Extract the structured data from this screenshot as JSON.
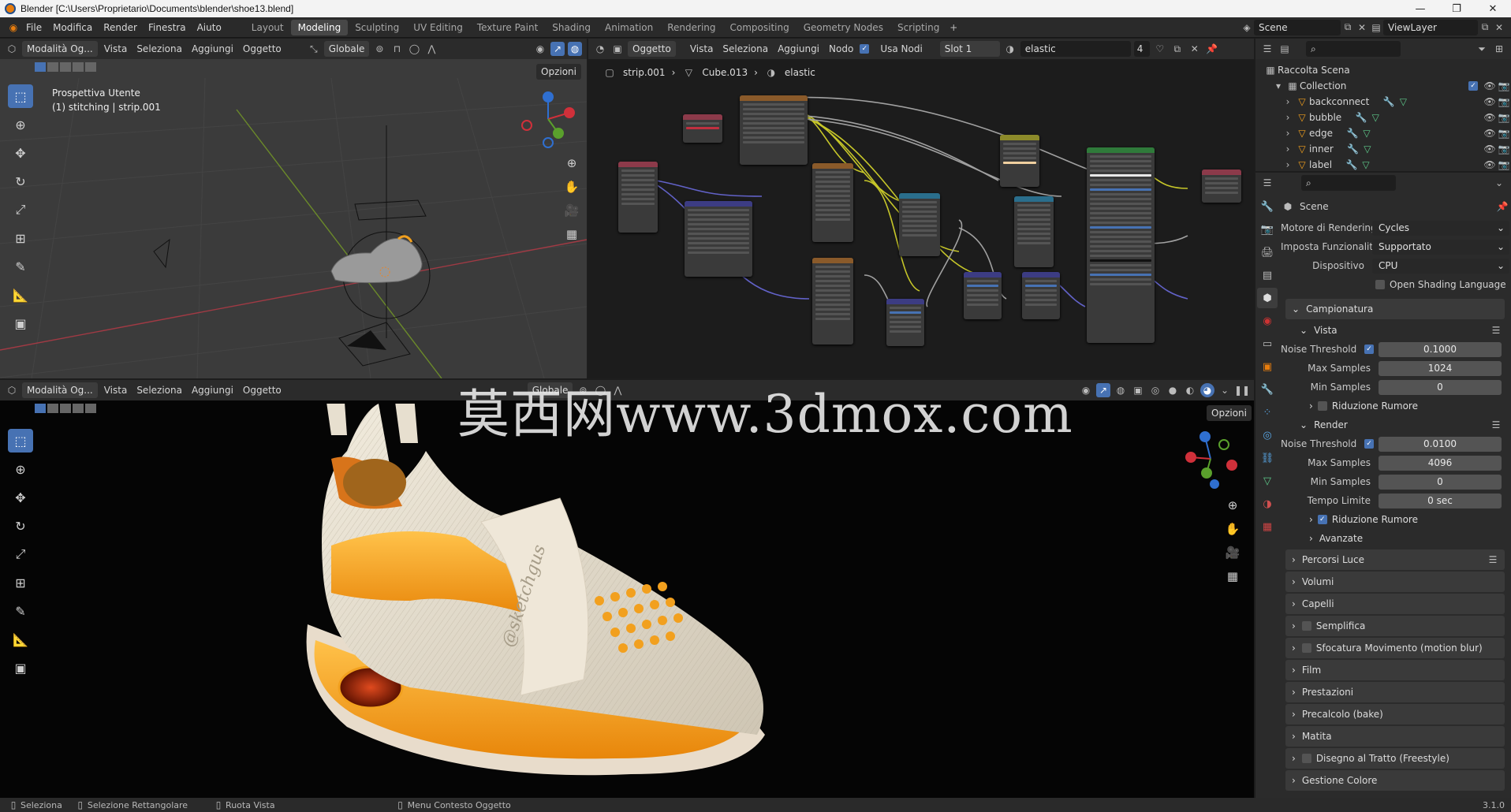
{
  "window": {
    "title": "Blender [C:\\Users\\Proprietario\\Documents\\blender\\shoe13.blend]"
  },
  "topbar": {
    "menus": [
      "File",
      "Modifica",
      "Render",
      "Finestra",
      "Aiuto"
    ],
    "workspaces": [
      "Layout",
      "Modeling",
      "Sculpting",
      "UV Editing",
      "Texture Paint",
      "Shading",
      "Animation",
      "Rendering",
      "Compositing",
      "Geometry Nodes",
      "Scripting"
    ],
    "active_workspace": "Modeling",
    "scene": "Scene",
    "viewlayer": "ViewLayer"
  },
  "viewport_top": {
    "mode": "Modalità Og...",
    "menus": [
      "Vista",
      "Seleziona",
      "Aggiungi",
      "Oggetto"
    ],
    "orientation": "Globale",
    "options": "Opzioni",
    "overlay_line1": "Prospettiva Utente",
    "overlay_line2": "(1) stitching | strip.001"
  },
  "node_editor": {
    "object_type": "Oggetto",
    "menus": [
      "Vista",
      "Seleziona",
      "Aggiungi",
      "Nodo"
    ],
    "use_nodes": "Usa Nodi",
    "slot": "Slot 1",
    "material": "elastic",
    "users": "4",
    "breadcrumb": [
      "strip.001",
      "Cube.013",
      "elastic"
    ]
  },
  "viewport_bottom": {
    "mode": "Modalità Og...",
    "menus": [
      "Vista",
      "Seleziona",
      "Aggiungi",
      "Oggetto"
    ],
    "orientation": "Globale",
    "options": "Opzioni",
    "watermark": "莫西网www.3dmox.com",
    "render_signature": "@sketchgus"
  },
  "outliner": {
    "root": "Raccolta Scena",
    "collection": "Collection",
    "items": [
      "backconnect",
      "bubble",
      "edge",
      "inner",
      "label"
    ]
  },
  "properties": {
    "context": "Scene",
    "engine_label": "Motore di Rendering",
    "engine": "Cycles",
    "feature_label": "Imposta Funzionalità",
    "feature": "Supportato",
    "device_label": "Dispositivo",
    "device": "CPU",
    "osl": "Open Shading Language",
    "sampling": "Campionatura",
    "vista": "Vista",
    "noise_threshold_label": "Noise Threshold",
    "vista_noise": "0.1000",
    "max_samples_label": "Max Samples",
    "vista_max": "1024",
    "min_samples_label": "Min Samples",
    "vista_min": "0",
    "denoise": "Riduzione Rumore",
    "render": "Render",
    "render_noise": "0.0100",
    "render_max": "4096",
    "render_min": "0",
    "time_limit_label": "Tempo Limite",
    "time_limit": "0 sec",
    "advanced": "Avanzate",
    "sections": [
      "Percorsi Luce",
      "Volumi",
      "Capelli",
      "Semplifica",
      "Sfocatura Movimento (motion blur)",
      "Film",
      "Prestazioni",
      "Precalcolo (bake)",
      "Matita",
      "Disegno al Tratto (Freestyle)",
      "Gestione Colore"
    ]
  },
  "statusbar": {
    "select": "Seleziona",
    "box_select": "Selezione Rettangolare",
    "rotate": "Ruota Vista",
    "context_menu": "Menu Contesto Oggetto",
    "version": "3.1.0"
  },
  "colors": {
    "accent": "#4772b3",
    "shoe_orange": "#f2a01e",
    "shoe_cream": "#e6ddcc"
  }
}
